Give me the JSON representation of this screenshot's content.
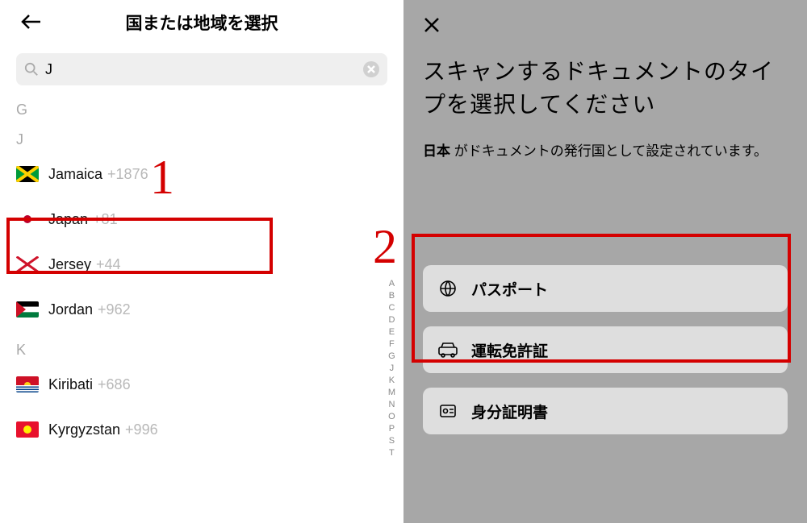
{
  "left": {
    "title": "国または地域を選択",
    "search_value": "J",
    "sections": [
      {
        "letter": "G",
        "items": []
      },
      {
        "letter": "J",
        "items": [
          {
            "flag": "jamaica",
            "name": "Jamaica",
            "code": "+1876"
          },
          {
            "flag": "japan",
            "name": "Japan",
            "code": "+81"
          },
          {
            "flag": "jersey",
            "name": "Jersey",
            "code": "+44"
          },
          {
            "flag": "jordan",
            "name": "Jordan",
            "code": "+962"
          }
        ]
      },
      {
        "letter": "K",
        "items": [
          {
            "flag": "kiribati",
            "name": "Kiribati",
            "code": "+686"
          },
          {
            "flag": "kyrgyzstan",
            "name": "Kyrgyzstan",
            "code": "+996"
          }
        ]
      }
    ],
    "alpha_index": [
      "A",
      "B",
      "C",
      "D",
      "E",
      "F",
      "G",
      "J",
      "K",
      "M",
      "N",
      "O",
      "P",
      "S",
      "T"
    ]
  },
  "right": {
    "title": "スキャンするドキュメントのタイプを選択してください",
    "sub_bold": "日本",
    "sub_rest": " がドキュメントの発行国として設定されています。",
    "docs": [
      {
        "icon": "globe",
        "label": "パスポート"
      },
      {
        "icon": "car",
        "label": "運転免許証"
      },
      {
        "icon": "idcard",
        "label": "身分証明書"
      }
    ]
  },
  "annotations": {
    "one": "1",
    "two": "2"
  }
}
